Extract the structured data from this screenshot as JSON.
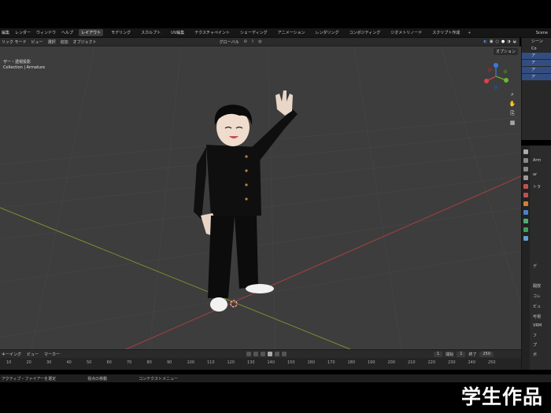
{
  "topbar": {
    "menus": [
      "編集",
      "レンダー",
      "ウィンドウ",
      "ヘルプ"
    ],
    "workspaces": [
      "レイアウト",
      "モデリング",
      "スカルプト",
      "UV編集",
      "テクスチャペイント",
      "シェーディング",
      "アニメーション",
      "レンダリング",
      "コンポジティング",
      "ジオメトリノード",
      "スクリプト作成"
    ],
    "active_workspace": "レイアウト",
    "add_label": "+",
    "scene_label": "Scene"
  },
  "header": {
    "mode": "リック モード",
    "menus": [
      "ビュー",
      "選択",
      "追加",
      "オブジェクト"
    ],
    "transform": "グローバル",
    "options": "オプション"
  },
  "viewport": {
    "view_name": "ザー・透視投影",
    "collection": "Collection | Armature"
  },
  "outliner": {
    "rows": [
      "シーン",
      "Co",
      "ア",
      "ア",
      "ア",
      "ア"
    ]
  },
  "properties": {
    "rows": [
      "Arm",
      "ar",
      "トラ",
      "デ",
      "開放",
      "コレ",
      "ビュ",
      "可視",
      "VRM",
      "フ",
      "プ",
      "ボ"
    ]
  },
  "timeline": {
    "menus": [
      "キーイング",
      "ビュー",
      "マーカー"
    ],
    "current_frame": "1",
    "start_label": "開始",
    "start": "1",
    "end_label": "終了",
    "end": "250",
    "ticks": [
      "10",
      "20",
      "30",
      "40",
      "50",
      "60",
      "70",
      "80",
      "90",
      "100",
      "110",
      "120",
      "130",
      "140",
      "150",
      "160",
      "170",
      "180",
      "190",
      "200",
      "210",
      "220",
      "230",
      "240",
      "250"
    ]
  },
  "statusbar": {
    "items": [
      "アクティブ・ファイアーを選定",
      "視点の移動",
      "コンテクストメニュー"
    ]
  },
  "caption": "学生作品",
  "colors": {
    "viewport_bg": "#3d3d3d",
    "x_axis": "#a84040",
    "y_axis": "#7d8f2e",
    "selection": "#334d80",
    "gizmo_x": "#e0404a",
    "gizmo_y": "#6ab830",
    "gizmo_z": "#3a7ae0"
  }
}
